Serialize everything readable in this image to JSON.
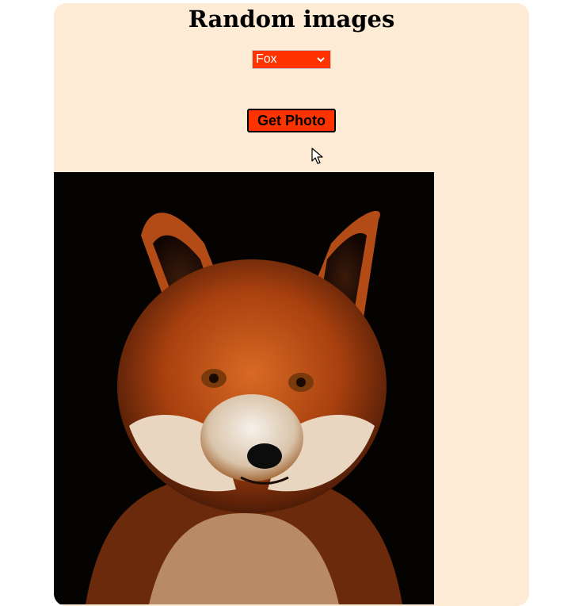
{
  "page": {
    "title": "Random images"
  },
  "animal_select": {
    "selected": "Fox",
    "background": "#ff3300"
  },
  "get_photo_button": {
    "label": "Get Photo",
    "background": "#ff3300"
  },
  "photo": {
    "subject": "red fox portrait",
    "background": "#050302"
  },
  "icons": {
    "select_arrow": "chevron-down-icon",
    "pointer": "mouse-cursor-icon"
  },
  "colors": {
    "card_background": "#fdebd5",
    "page_background": "#ffffff"
  }
}
